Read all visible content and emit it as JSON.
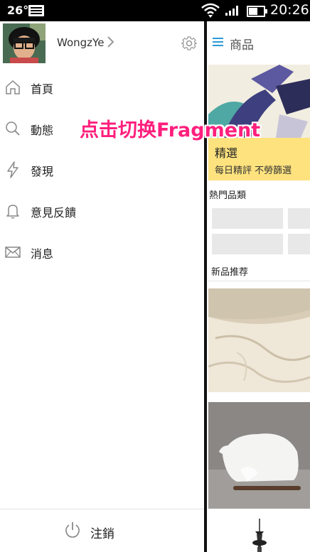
{
  "status_bar": {
    "temperature": "26°",
    "time": "20:26"
  },
  "drawer": {
    "profile": {
      "username": "WongzYe"
    },
    "menu": [
      {
        "label": "首頁",
        "icon": "home-icon"
      },
      {
        "label": "動態",
        "icon": "search-icon"
      },
      {
        "label": "發現",
        "icon": "lightning-icon"
      },
      {
        "label": "意見反饋",
        "icon": "bell-icon"
      },
      {
        "label": "消息",
        "icon": "mail-icon"
      }
    ],
    "logout_label": "注銷"
  },
  "content": {
    "title": "商品",
    "featured": {
      "title": "精選",
      "subtitle": "每日精評 不勞篩選"
    },
    "category_section": "熱門品類",
    "new_section": "新品推荐"
  },
  "overlay_text": "点击切换Fragment",
  "colors": {
    "accent_blue": "#2c9ad6",
    "featured_yellow": "#fde27e",
    "overlay_pink": "#ff1f7d"
  }
}
